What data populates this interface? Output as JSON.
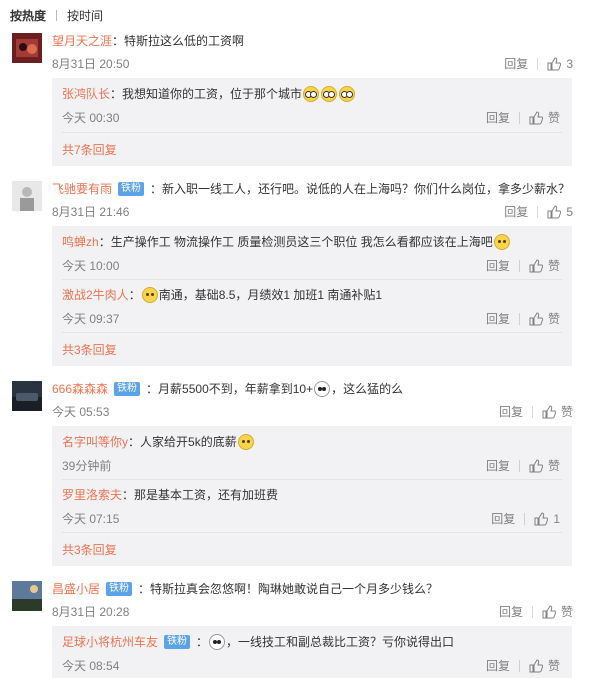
{
  "sort": {
    "hot": "按热度",
    "time": "按时间"
  },
  "labels": {
    "reply": "回复",
    "like": "赞",
    "fan_badge": "铁粉"
  },
  "colors": {
    "username": "#eb7350",
    "meta": "#808080",
    "reply_bg": "#f2f2f5",
    "badge": "#5ba3e6"
  },
  "comments": [
    {
      "user": "望月天之涯",
      "has_badge": false,
      "text": "特斯拉这么低的工资啊",
      "time": "8月31日 20:50",
      "likes": "3",
      "replies": [
        {
          "user": "张鸿队长",
          "text": "我想知道你的工资，位于那个城市",
          "emoji": "glasses-emoji x3",
          "time": "今天 00:30",
          "likes": "赞"
        }
      ],
      "more": "共7条回复"
    },
    {
      "user": "飞驰要有雨",
      "has_badge": true,
      "text": "新入职一线工人，还行吧。说低的人在上海吗？你们什么岗位，拿多少薪水？",
      "time": "8月31日 21:46",
      "likes": "5",
      "replies": [
        {
          "user": "鸣蝉zh",
          "text": "生产操作工 物流操作工 质量检测员这三个职位 我怎么看都应该在上海吧",
          "emoji": "sweat-emoji",
          "time": "今天 10:00",
          "likes": "赞"
        },
        {
          "user": "激战2牛肉人",
          "text": "南通，基础8.5，月绩效1 加班1 南通补贴1",
          "emoji": "doubt-emoji",
          "time": "今天 09:37",
          "likes": "赞"
        }
      ],
      "more": "共3条回复"
    },
    {
      "user": "666森森森",
      "has_badge": true,
      "text_a": "月薪5500不到，年薪拿到10+",
      "text_b": "，这么猛的么",
      "time": "今天 05:53",
      "likes": "赞",
      "replies": [
        {
          "user": "名字叫等你y",
          "text": "人家给开5k的底薪",
          "emoji": "smirk-emoji",
          "time": "39分钟前",
          "likes": "赞"
        },
        {
          "user": "罗里洛索夫",
          "text": "那是基本工资，还有加班费",
          "time": "今天 07:15",
          "likes": "1"
        }
      ],
      "more": "共3条回复"
    },
    {
      "user": "昌盛小居",
      "has_badge": true,
      "text": "特斯拉真会忽悠啊！陶琳她敢说自己一个月多少钱么？",
      "time": "8月31日 20:28",
      "likes": "赞",
      "replies": [
        {
          "user": "足球小将杭州车友",
          "has_badge": true,
          "text": "，一线技工和副总裁比工资？亏你说得出口",
          "emoji": "panda-emoji",
          "time": "今天 08:54",
          "likes": "赞"
        }
      ]
    }
  ]
}
